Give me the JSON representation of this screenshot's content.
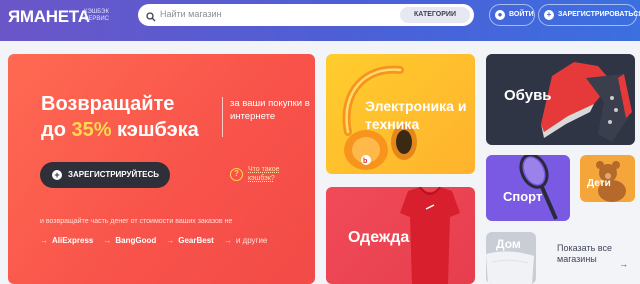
{
  "header": {
    "logo": "ЯМАНЕТА",
    "logo_sub": "кэшбэк сервис",
    "search_placeholder": "Найти магазин",
    "categories_label": "КАТЕГОРИИ",
    "login_label": "ВОЙТИ",
    "register_label": "ЗАРЕГИСТРИРОВАТЬСЯ"
  },
  "hero": {
    "title_line1": "Возвращайте",
    "title_prefix": "до ",
    "title_percent": "35%",
    "title_suffix": " кэшбэка",
    "subtitle": "за ваши покупки в интернете",
    "register_button": "ЗАРЕГИСТРИРУЙТЕСЬ",
    "what_is_cashback": "Что такое кэшбэк?",
    "note": "и возвращайте часть денег от стоимости ваших заказов не",
    "shops": [
      "AliExpress",
      "BangGood",
      "GearBest",
      "и другие"
    ]
  },
  "categories": {
    "electronics": "Электроника и техника",
    "clothes": "Одежда",
    "shoes": "Обувь",
    "sport": "Спорт",
    "kids": "Дети",
    "home": "Дом"
  },
  "show_all": {
    "label": "Показать все магазины",
    "arrow": "→"
  },
  "colors": {
    "header_gradient_start": "#6b56c8",
    "header_gradient_end": "#3c6fe0",
    "hero_accent": "#ffd84f",
    "hero_bg": "#f8524a"
  }
}
